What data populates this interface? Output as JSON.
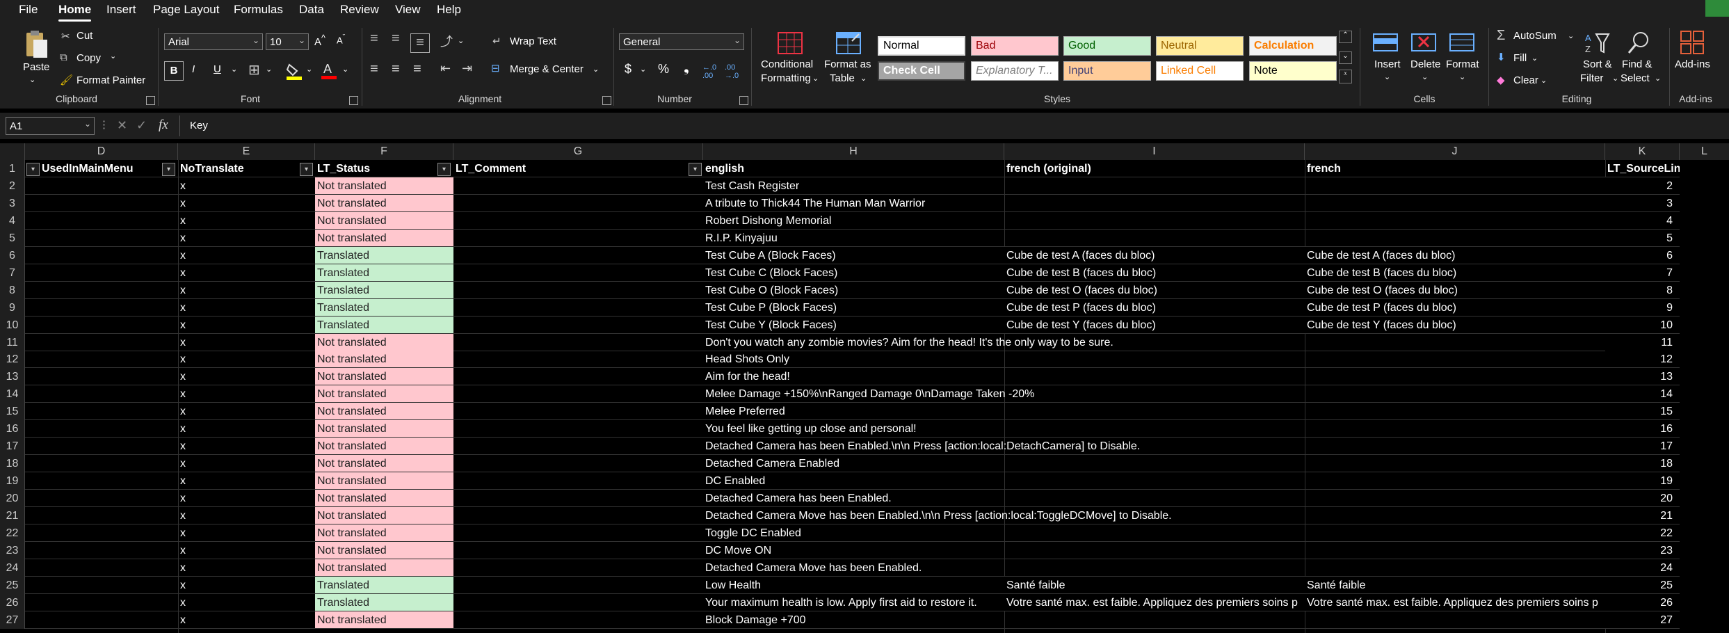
{
  "menu": [
    "File",
    "Home",
    "Insert",
    "Page Layout",
    "Formulas",
    "Data",
    "Review",
    "View",
    "Help"
  ],
  "ribbon": {
    "clipboard": {
      "paste": "Paste",
      "cut": "Cut",
      "copy": "Copy",
      "format_painter": "Format Painter",
      "label": "Clipboard"
    },
    "font": {
      "name": "Arial",
      "size": "10",
      "label": "Font",
      "bold": "B",
      "italic": "I",
      "underline": "U"
    },
    "alignment": {
      "wrap": "Wrap Text",
      "merge": "Merge & Center",
      "label": "Alignment"
    },
    "number": {
      "format": "General",
      "label": "Number",
      "currency": "$",
      "percent": "%",
      "comma": "❟"
    },
    "styles": {
      "conditional": "Conditional",
      "conditional2": "Formatting",
      "format_as": "Format as",
      "table": "Table",
      "label": "Styles",
      "cells": [
        {
          "label": "Normal",
          "bg": "#ffffff",
          "fg": "#000000"
        },
        {
          "label": "Bad",
          "bg": "#ffc7ce",
          "fg": "#9c0006"
        },
        {
          "label": "Good",
          "bg": "#c6efce",
          "fg": "#006100"
        },
        {
          "label": "Neutral",
          "bg": "#ffeb9c",
          "fg": "#9c6500"
        },
        {
          "label": "Calculation",
          "bg": "#f2f2f2",
          "fg": "#fa7d00"
        },
        {
          "label": "Check Cell",
          "bg": "#a5a5a5",
          "fg": "#ffffff"
        },
        {
          "label": "Explanatory T...",
          "bg": "#ffffff",
          "fg": "#7f7f7f"
        },
        {
          "label": "Input",
          "bg": "#ffcc99",
          "fg": "#3f3f76"
        },
        {
          "label": "Linked Cell",
          "bg": "#ffffff",
          "fg": "#fa7d00"
        },
        {
          "label": "Note",
          "bg": "#ffffcc",
          "fg": "#000000"
        }
      ]
    },
    "cells": {
      "insert": "Insert",
      "delete": "Delete",
      "format": "Format",
      "label": "Cells"
    },
    "editing": {
      "autosum": "AutoSum",
      "fill": "Fill",
      "clear": "Clear",
      "sort": "Sort &",
      "filter": "Filter",
      "find": "Find &",
      "select": "Select",
      "label": "Editing"
    },
    "addins": {
      "button": "Add-ins",
      "label": "Add-ins"
    }
  },
  "formula_bar": {
    "name_box": "A1",
    "content": "Key"
  },
  "columns": [
    {
      "letter": "D",
      "header": "UsedInMainMenu"
    },
    {
      "letter": "E",
      "header": "NoTranslate"
    },
    {
      "letter": "F",
      "header": "LT_Status"
    },
    {
      "letter": "G",
      "header": "LT_Comment"
    },
    {
      "letter": "H",
      "header": "english"
    },
    {
      "letter": "I",
      "header": "french (original)"
    },
    {
      "letter": "J",
      "header": "french"
    },
    {
      "letter": "K",
      "header": "LT_SourceLine"
    },
    {
      "letter": "L",
      "header": ""
    }
  ],
  "header_row": "1",
  "rows": [
    {
      "n": "2",
      "e": "x",
      "status": "Not translated",
      "english": "Test Cash Register",
      "fr_orig": "",
      "fr": "",
      "line": "2"
    },
    {
      "n": "3",
      "e": "x",
      "status": "Not translated",
      "english": "A tribute to Thick44 The Human Man Warrior",
      "fr_orig": "",
      "fr": "",
      "line": "3"
    },
    {
      "n": "4",
      "e": "x",
      "status": "Not translated",
      "english": "Robert Dishong Memorial",
      "fr_orig": "",
      "fr": "",
      "line": "4"
    },
    {
      "n": "5",
      "e": "x",
      "status": "Not translated",
      "english": "R.I.P. Kinyajuu",
      "fr_orig": "",
      "fr": "",
      "line": "5"
    },
    {
      "n": "6",
      "e": "x",
      "status": "Translated",
      "english": "Test Cube A (Block Faces)",
      "fr_orig": "Cube de test A (faces du bloc)",
      "fr": "Cube de test A (faces du bloc)",
      "line": "6"
    },
    {
      "n": "7",
      "e": "x",
      "status": "Translated",
      "english": "Test Cube C (Block Faces)",
      "fr_orig": "Cube de test B (faces du bloc)",
      "fr": "Cube de test B (faces du bloc)",
      "line": "7"
    },
    {
      "n": "8",
      "e": "x",
      "status": "Translated",
      "english": "Test Cube O (Block Faces)",
      "fr_orig": "Cube de test O (faces du bloc)",
      "fr": "Cube de test O (faces du bloc)",
      "line": "8"
    },
    {
      "n": "9",
      "e": "x",
      "status": "Translated",
      "english": "Test Cube P (Block Faces)",
      "fr_orig": "Cube de test P (faces du bloc)",
      "fr": "Cube de test P (faces du bloc)",
      "line": "9"
    },
    {
      "n": "10",
      "e": "x",
      "status": "Translated",
      "english": "Test Cube Y (Block Faces)",
      "fr_orig": "Cube de test Y (faces du bloc)",
      "fr": "Cube de test Y (faces du bloc)",
      "line": "10"
    },
    {
      "n": "11",
      "e": "x",
      "status": "Not translated",
      "english": "Don't you watch any zombie movies? Aim for the head! It's the only way to be sure.",
      "fr_orig": "",
      "fr": "",
      "line": "11"
    },
    {
      "n": "12",
      "e": "x",
      "status": "Not translated",
      "english": "Head Shots Only",
      "fr_orig": "",
      "fr": "",
      "line": "12"
    },
    {
      "n": "13",
      "e": "x",
      "status": "Not translated",
      "english": "Aim for the head!",
      "fr_orig": "",
      "fr": "",
      "line": "13"
    },
    {
      "n": "14",
      "e": "x",
      "status": "Not translated",
      "english": "Melee Damage +150%\\nRanged Damage 0\\nDamage Taken -20%",
      "fr_orig": "",
      "fr": "",
      "line": "14"
    },
    {
      "n": "15",
      "e": "x",
      "status": "Not translated",
      "english": "Melee Preferred",
      "fr_orig": "",
      "fr": "",
      "line": "15"
    },
    {
      "n": "16",
      "e": "x",
      "status": "Not translated",
      "english": "You feel like getting up close and personal!",
      "fr_orig": "",
      "fr": "",
      "line": "16"
    },
    {
      "n": "17",
      "e": "x",
      "status": "Not translated",
      "english": "Detached Camera has been Enabled.\\n\\n Press [action:local:DetachCamera] to Disable.",
      "fr_orig": "",
      "fr": "",
      "line": "17"
    },
    {
      "n": "18",
      "e": "x",
      "status": "Not translated",
      "english": "Detached Camera Enabled",
      "fr_orig": "",
      "fr": "",
      "line": "18"
    },
    {
      "n": "19",
      "e": "x",
      "status": "Not translated",
      "english": "DC Enabled",
      "fr_orig": "",
      "fr": "",
      "line": "19"
    },
    {
      "n": "20",
      "e": "x",
      "status": "Not translated",
      "english": "Detached Camera has been Enabled.",
      "fr_orig": "",
      "fr": "",
      "line": "20"
    },
    {
      "n": "21",
      "e": "x",
      "status": "Not translated",
      "english": "Detached Camera Move has been Enabled.\\n\\n Press [action:local:ToggleDCMove] to Disable.",
      "fr_orig": "",
      "fr": "",
      "line": "21"
    },
    {
      "n": "22",
      "e": "x",
      "status": "Not translated",
      "english": "Toggle DC Enabled",
      "fr_orig": "",
      "fr": "",
      "line": "22"
    },
    {
      "n": "23",
      "e": "x",
      "status": "Not translated",
      "english": "DC Move ON",
      "fr_orig": "",
      "fr": "",
      "line": "23"
    },
    {
      "n": "24",
      "e": "x",
      "status": "Not translated",
      "english": "Detached Camera Move has been Enabled.",
      "fr_orig": "",
      "fr": "",
      "line": "24"
    },
    {
      "n": "25",
      "e": "x",
      "status": "Translated",
      "english": "Low Health",
      "fr_orig": "Santé faible",
      "fr": "Santé faible",
      "line": "25"
    },
    {
      "n": "26",
      "e": "x",
      "status": "Translated",
      "english": "Your maximum health is low. Apply first aid to restore it.",
      "fr_orig": "Votre santé max. est faible. Appliquez des premiers soins p",
      "fr": "Votre santé max. est faible. Appliquez des premiers soins p",
      "line": "26"
    },
    {
      "n": "27",
      "e": "x",
      "status": "Not translated",
      "english": "Block Damage +700",
      "fr_orig": "",
      "fr": "",
      "line": "27"
    }
  ]
}
